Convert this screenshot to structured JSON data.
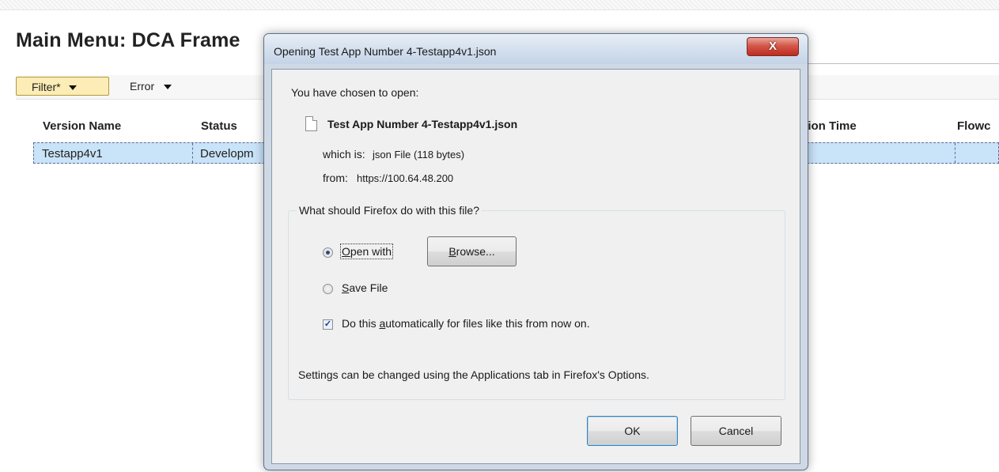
{
  "page": {
    "title": "Main Menu: DCA Frame",
    "toolbar": {
      "filter_label": "Filter*",
      "error_label": "Error"
    }
  },
  "grid": {
    "columns": [
      "Version Name",
      "Status",
      "ction Time",
      "Flowc"
    ],
    "rows": [
      {
        "version_name": "Testapp4v1",
        "status": "Developm"
      }
    ]
  },
  "dialog": {
    "title": "Opening Test App Number 4-Testapp4v1.json",
    "close_label": "X",
    "intro": "You have chosen to open:",
    "file_name": "Test App Number 4-Testapp4v1.json",
    "which_is_label": "which is:",
    "which_is_value": "json File (118 bytes)",
    "from_label": "from:",
    "from_value": "https://100.64.48.200",
    "group_label": "What should Firefox do with this file?",
    "open_with": {
      "pre": "",
      "u": "O",
      "post": "pen with"
    },
    "browse": {
      "pre": "",
      "u": "B",
      "post": "rowse..."
    },
    "save_file": {
      "pre": "",
      "u": "S",
      "post": "ave File"
    },
    "auto": {
      "pre": "Do this ",
      "u": "a",
      "post": "utomatically for files like this from now on."
    },
    "settings_note": "Settings can be changed using the Applications tab in Firefox's Options.",
    "ok_label": "OK",
    "cancel_label": "Cancel",
    "open_with_selected": true,
    "save_file_selected": false,
    "auto_checked": true,
    "check_glyph": "✓"
  }
}
